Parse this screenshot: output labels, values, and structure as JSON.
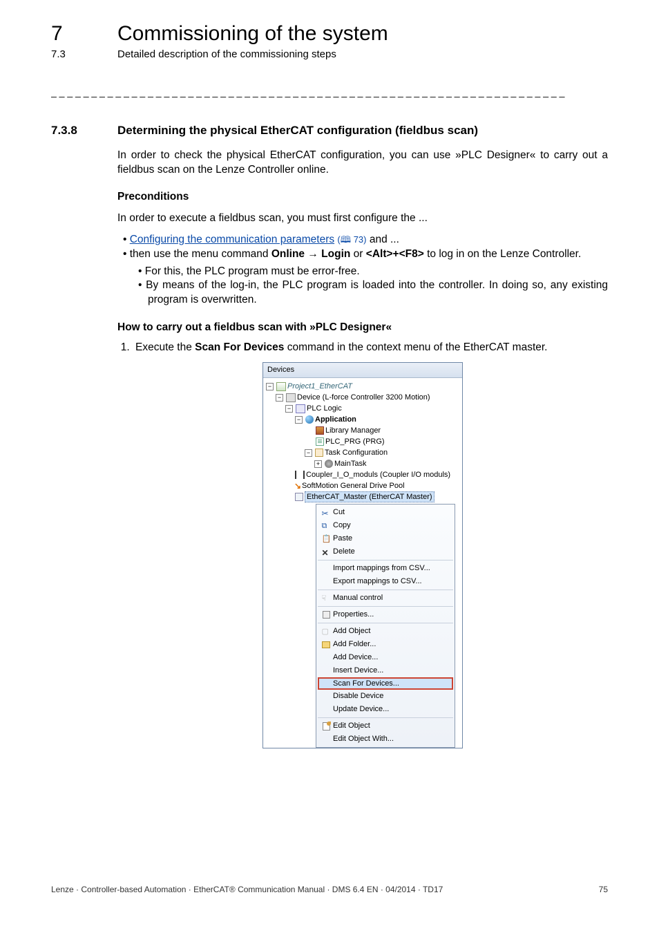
{
  "header": {
    "chapter_num": "7",
    "chapter_title": "Commissioning of the system",
    "section_num": "7.3",
    "section_title": "Detailed description of the commissioning steps"
  },
  "dashes": "_ _ _ _ _ _ _ _ _ _ _ _ _ _ _ _ _ _ _ _ _ _ _ _ _ _ _ _ _ _ _ _ _ _ _ _ _ _ _ _ _ _ _ _ _ _ _ _ _ _ _ _ _ _ _ _ _ _ _ _ _ _ _ _",
  "section": {
    "num": "7.3.8",
    "title": "Determining the physical EtherCAT configuration (fieldbus scan)"
  },
  "p_intro": "In order to check the physical EtherCAT configuration, you can use »PLC Designer« to carry out a fieldbus scan on the Lenze Controller online.",
  "h_precond": "Preconditions",
  "p_precond": "In order to execute a fieldbus scan, you must first configure the ...",
  "link_text": "Configuring the communication parameters",
  "link_ref_page": "73",
  "link_tail": " and ...",
  "b2_pre": "then use the menu command ",
  "b2_online": "Online",
  "b2_arrow": " → ",
  "b2_login": "Login",
  "b2_or": " or ",
  "b2_keys": "<Alt>+<F8>",
  "b2_post": " to log in on the Lenze Controller.",
  "sub1": "For this, the PLC program must be error-free.",
  "sub2": "By means of the log-in, the PLC program is loaded into the controller. In doing so, any existing program is overwritten.",
  "howto": "How to carry out a fieldbus scan with »PLC Designer«",
  "step1_pre": "Execute the ",
  "step1_bold": "Scan For Devices",
  "step1_post": " command in the context menu of the EtherCAT master.",
  "shot": {
    "title": "Devices",
    "project": "Project1_EtherCAT",
    "device": "Device (L-force Controller 3200 Motion)",
    "plclogic": "PLC Logic",
    "application": "Application",
    "libmgr": "Library Manager",
    "prg": "PLC_PRG (PRG)",
    "taskcfg": "Task Configuration",
    "maintask": "MainTask",
    "coupler": "Coupler_I_O_moduls (Coupler I/O moduls)",
    "softmotion": "SoftMotion General Drive Pool",
    "ecatmaster": "EtherCAT_Master (EtherCAT Master)",
    "ctx": {
      "cut": "Cut",
      "copy": "Copy",
      "paste": "Paste",
      "delete": "Delete",
      "impcsv": "Import mappings from CSV...",
      "expcsv": "Export mappings to CSV...",
      "manual": "Manual control",
      "props": "Properties...",
      "addobj": "Add Object",
      "addfold": "Add Folder...",
      "adddev": "Add Device...",
      "insdev": "Insert Device...",
      "scan": "Scan For Devices...",
      "disable": "Disable Device",
      "update": "Update Device...",
      "editobj": "Edit Object",
      "editwith": "Edit Object With..."
    }
  },
  "footer_left": "Lenze · Controller-based Automation · EtherCAT® Communication Manual · DMS 6.4 EN · 04/2014 · TD17",
  "footer_right": "75"
}
